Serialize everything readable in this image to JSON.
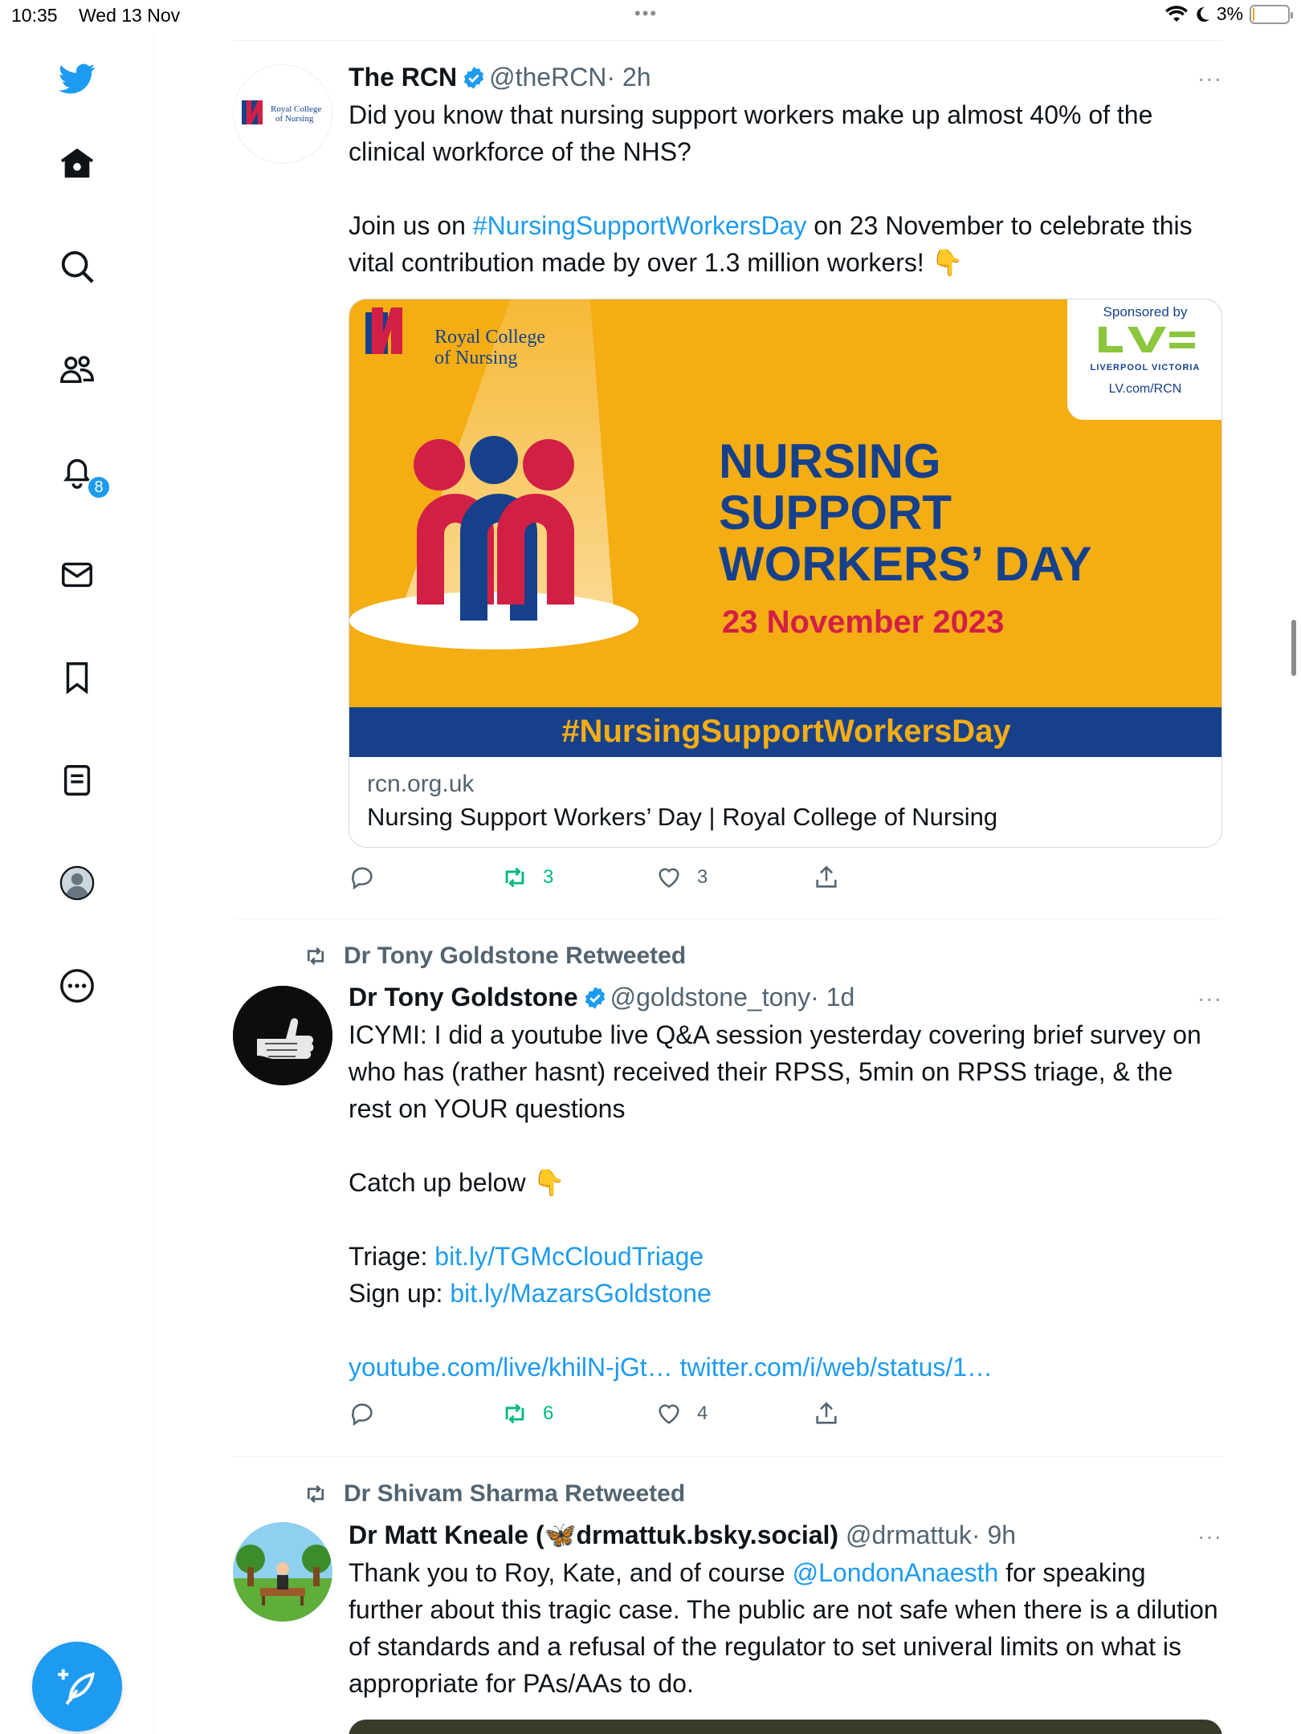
{
  "status_bar": {
    "time": "10:35",
    "date": "Wed 13 Nov",
    "dots": "•••",
    "battery": "3%",
    "battery_level": 0.03
  },
  "sidebar": {
    "notifications_badge": "8",
    "accent_color": "#1d9bf0"
  },
  "tweets": [
    {
      "name": "The RCN",
      "handle": "@theRCN",
      "meta": "· 2h",
      "more": "···",
      "text_1": "Did you know that nursing support workers make up almost 40% of the clinical workforce of the NHS?\n\nJoin us on ",
      "hashtag": "#NursingSupportWorkersDay",
      "text_2": " on 23 November to celebrate this vital contribution made by over 1.3 million workers! 👇",
      "avatar_logo": "Royal College of Nursing",
      "card": {
        "logo_line1": "Royal College",
        "logo_line2": "of Nursing",
        "sponsored_by": "Sponsored by",
        "sponsor_logo": "LV=",
        "sponsor_name": "LIVERPOOL VICTORIA",
        "sponsor_url": "LV.com/RCN",
        "title_1": "NURSING",
        "title_2": "SUPPORT",
        "title_3": "WORKERS’ DAY",
        "date": "23 November 2023",
        "hashtag_bar": "#NursingSupportWorkersDay",
        "domain": "rcn.org.uk",
        "link_title": "Nursing Support Workers’ Day | Royal College of Nursing"
      },
      "retweets": "3",
      "likes": "3"
    },
    {
      "retweeted_by": "Dr Tony Goldstone Retweeted",
      "name": "Dr Tony Goldstone",
      "handle": "@goldstone_tony",
      "meta": "· 1d",
      "more": "···",
      "text_1": "ICYMI: I did a youtube live Q&A session yesterday covering brief survey on who has (rather hasnt) received their RPSS, 5min on RPSS triage, & the rest on YOUR questions\n\nCatch up below 👇\n\nTriage: ",
      "link_1": "bit.ly/TGMcCloudTriage",
      "text_2": "\nSign up: ",
      "link_2": "bit.ly/MazarsGoldstone",
      "text_3": "\n\n",
      "link_3": "youtube.com/live/khilN-jGt…",
      "text_4": " ",
      "link_4": "twitter.com/i/web/status/1…",
      "retweets": "6",
      "likes": "4"
    },
    {
      "retweeted_by": "Dr Shivam Sharma Retweeted",
      "name": "Dr Matt Kneale (🦋drmattuk.bsky.social)",
      "handle": "@drmattuk",
      "meta": "· 9h",
      "more": "···",
      "text_1": "Thank you to Roy, Kate, and of course ",
      "mention": "@LondonAnaesth",
      "text_2": " for speaking further about this tragic case. The public are not safe when there is a dilution of standards and a refusal of the regulator to set univeral limits on what is appropriate for PAs/AAs to do."
    }
  ]
}
